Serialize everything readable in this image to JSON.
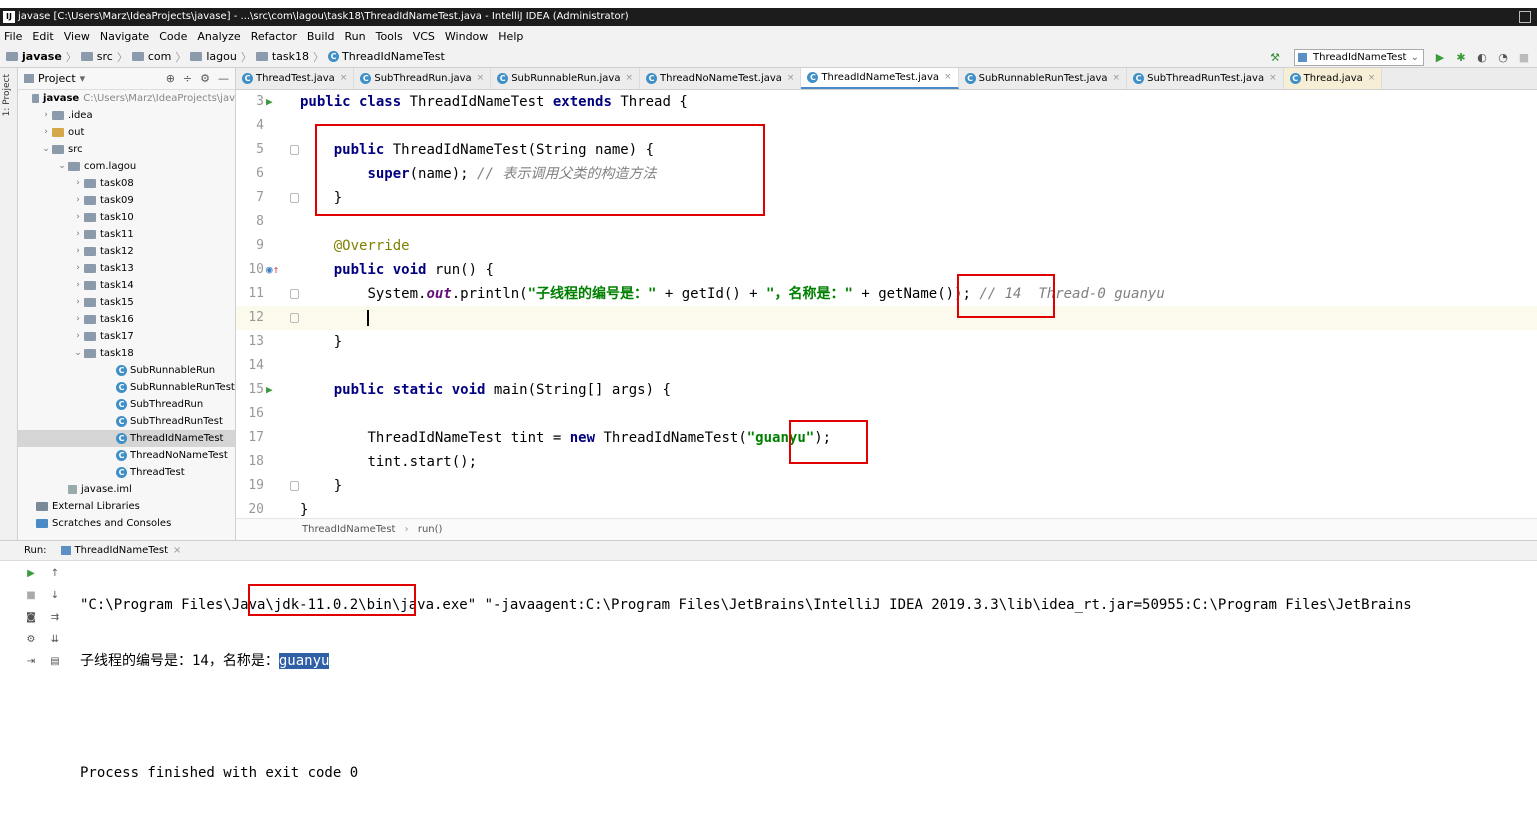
{
  "window": {
    "title": "javase [C:\\Users\\Marz\\IdeaProjects\\javase] - ...\\src\\com\\lagou\\task18\\ThreadIdNameTest.java - IntelliJ IDEA (Administrator)"
  },
  "menu": [
    "File",
    "Edit",
    "View",
    "Navigate",
    "Code",
    "Analyze",
    "Refactor",
    "Build",
    "Run",
    "Tools",
    "VCS",
    "Window",
    "Help"
  ],
  "breadcrumb": [
    "javase",
    "src",
    "com",
    "lagou",
    "task18",
    "ThreadIdNameTest"
  ],
  "run_config": "ThreadIdNameTest",
  "side_strip_label": "1: Project",
  "project": {
    "header": "Project",
    "root_name": "javase",
    "root_path": "C:\\Users\\Marz\\IdeaProjects\\jav",
    "rows": [
      {
        "label": "javase",
        "indent": 0,
        "arrow": "",
        "type": "module"
      },
      {
        "label": ".idea",
        "indent": 1,
        "arrow": ">",
        "type": "folder"
      },
      {
        "label": "out",
        "indent": 1,
        "arrow": ">",
        "type": "folder-y"
      },
      {
        "label": "src",
        "indent": 1,
        "arrow": "v",
        "type": "folder"
      },
      {
        "label": "com.lagou",
        "indent": 2,
        "arrow": "v",
        "type": "folder"
      },
      {
        "label": "task08",
        "indent": 3,
        "arrow": ">",
        "type": "folder"
      },
      {
        "label": "task09",
        "indent": 3,
        "arrow": ">",
        "type": "folder"
      },
      {
        "label": "task10",
        "indent": 3,
        "arrow": ">",
        "type": "folder"
      },
      {
        "label": "task11",
        "indent": 3,
        "arrow": ">",
        "type": "folder"
      },
      {
        "label": "task12",
        "indent": 3,
        "arrow": ">",
        "type": "folder"
      },
      {
        "label": "task13",
        "indent": 3,
        "arrow": ">",
        "type": "folder"
      },
      {
        "label": "task14",
        "indent": 3,
        "arrow": ">",
        "type": "folder"
      },
      {
        "label": "task15",
        "indent": 3,
        "arrow": ">",
        "type": "folder"
      },
      {
        "label": "task16",
        "indent": 3,
        "arrow": ">",
        "type": "folder"
      },
      {
        "label": "task17",
        "indent": 3,
        "arrow": ">",
        "type": "folder"
      },
      {
        "label": "task18",
        "indent": 3,
        "arrow": "v",
        "type": "folder"
      },
      {
        "label": "SubRunnableRun",
        "indent": 5,
        "arrow": "",
        "type": "class"
      },
      {
        "label": "SubRunnableRunTest",
        "indent": 5,
        "arrow": "",
        "type": "class"
      },
      {
        "label": "SubThreadRun",
        "indent": 5,
        "arrow": "",
        "type": "class"
      },
      {
        "label": "SubThreadRunTest",
        "indent": 5,
        "arrow": "",
        "type": "class"
      },
      {
        "label": "ThreadIdNameTest",
        "indent": 5,
        "arrow": "",
        "type": "class",
        "selected": true
      },
      {
        "label": "ThreadNoNameTest",
        "indent": 5,
        "arrow": "",
        "type": "class"
      },
      {
        "label": "ThreadTest",
        "indent": 5,
        "arrow": "",
        "type": "class"
      },
      {
        "label": "javase.iml",
        "indent": 2,
        "arrow": "",
        "type": "file"
      },
      {
        "label": "External Libraries",
        "indent": 0,
        "arrow": "",
        "type": "lib"
      },
      {
        "label": "Scratches and Consoles",
        "indent": 0,
        "arrow": "",
        "type": "scratch"
      }
    ]
  },
  "tabs": [
    {
      "label": "ThreadTest.java",
      "active": false
    },
    {
      "label": "SubThreadRun.java",
      "active": false
    },
    {
      "label": "SubRunnableRun.java",
      "active": false
    },
    {
      "label": "ThreadNoNameTest.java",
      "active": false
    },
    {
      "label": "ThreadIdNameTest.java",
      "active": true
    },
    {
      "label": "SubRunnableRunTest.java",
      "active": false
    },
    {
      "label": "SubThreadRunTest.java",
      "active": false
    },
    {
      "label": "Thread.java",
      "active": false,
      "gold": true
    }
  ],
  "code": {
    "line_numbers": [
      "3",
      "4",
      "5",
      "6",
      "7",
      "8",
      "9",
      "10",
      "11",
      "12",
      "13",
      "14",
      "15",
      "16",
      "17",
      "18",
      "19",
      "20"
    ],
    "l3": {
      "kw1": "public class ",
      "name": "ThreadIdNameTest ",
      "kw2": "extends ",
      "rest": "Thread {"
    },
    "l5": {
      "kw": "public ",
      "rest": "ThreadIdNameTest(String name) {"
    },
    "l6": {
      "kw": "super",
      "rest": "(name); ",
      "cmt": "// 表示调用父类的构造方法"
    },
    "l7": {
      "rest": "}"
    },
    "l9": {
      "ann": "@Override"
    },
    "l10": {
      "kw": "public void ",
      "rest": "run() {"
    },
    "l11": {
      "a": "System.",
      "b": "out",
      "c": ".println(",
      "s1": "\"子线程的编号是：\"",
      "d": " + getId() + ",
      "s2": "\"，名称是：\"",
      "e": " + getName()); ",
      "cmt": "// 14  Thread-0 guanyu"
    },
    "l13": {
      "rest": "}"
    },
    "l15": {
      "kw": "public static void ",
      "rest": "main(String[] args) {"
    },
    "l17": {
      "a": "ThreadIdNameTest tint = ",
      "kw": "new ",
      "b": "ThreadIdNameTest(",
      "s": "\"guanyu\"",
      "c": ");"
    },
    "l18": {
      "rest": "tint.start();"
    },
    "l19": {
      "rest": "}"
    },
    "l20": {
      "rest": "}"
    }
  },
  "editor_crumb": [
    "ThreadIdNameTest",
    "run()"
  ],
  "run_panel": {
    "label": "Run:",
    "tab": "ThreadIdNameTest",
    "cmd": "\"C:\\Program Files\\Java\\jdk-11.0.2\\bin\\java.exe\" \"-javaagent:C:\\Program Files\\JetBrains\\IntelliJ IDEA 2019.3.3\\lib\\idea_rt.jar=50955:C:\\Program Files\\JetBrains",
    "out_prefix": "子线程的编号是：14，名称是：",
    "out_name": "guanyu",
    "exit": "Process finished with exit code 0"
  }
}
